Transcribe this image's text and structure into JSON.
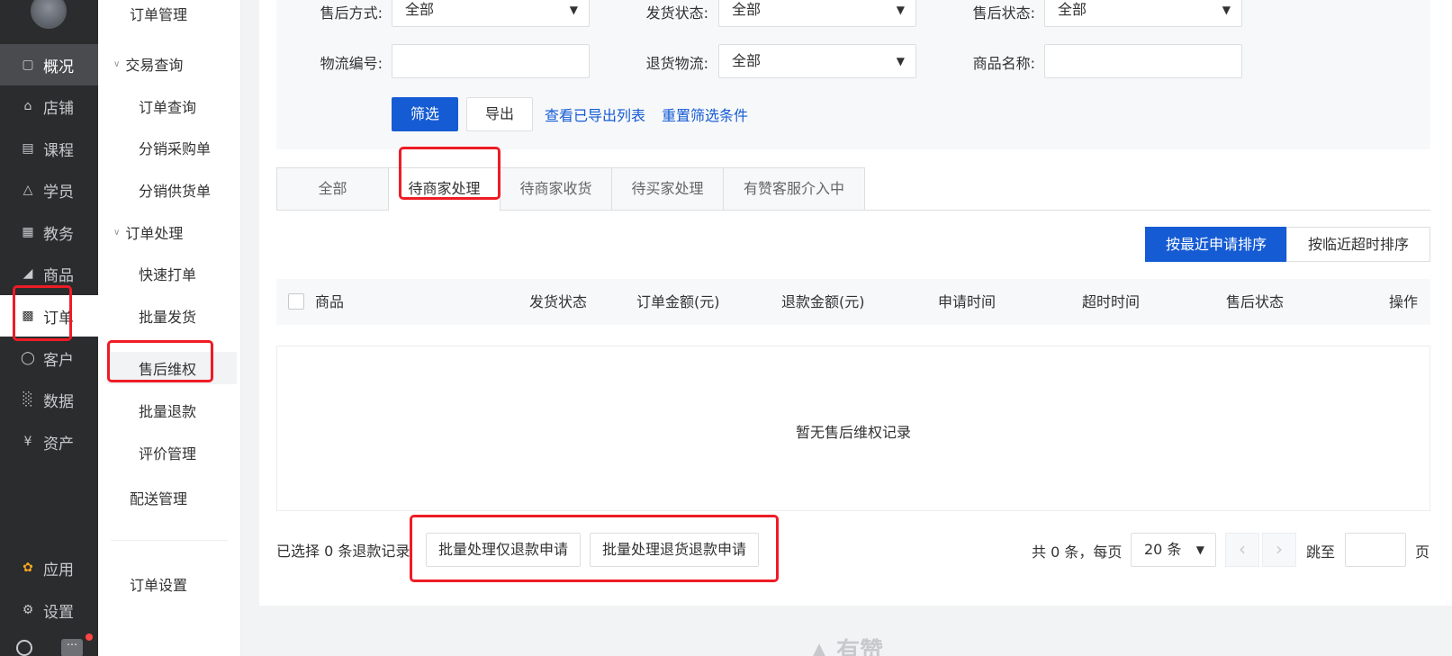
{
  "nav_primary": {
    "items": [
      {
        "label": "概况",
        "icon": "monitor-icon"
      },
      {
        "label": "店铺",
        "icon": "store-icon"
      },
      {
        "label": "课程",
        "icon": "book-icon"
      },
      {
        "label": "学员",
        "icon": "graduation-cap-icon"
      },
      {
        "label": "教务",
        "icon": "calendar-icon"
      },
      {
        "label": "商品",
        "icon": "tag-icon"
      },
      {
        "label": "订单",
        "icon": "order-doc-icon"
      },
      {
        "label": "客户",
        "icon": "user-icon"
      },
      {
        "label": "数据",
        "icon": "bar-chart-icon"
      },
      {
        "label": "资产",
        "icon": "yen-circle-icon"
      },
      {
        "label": "应用",
        "icon": "apps-icon"
      },
      {
        "label": "设置",
        "icon": "gear-icon"
      }
    ]
  },
  "nav_secondary": {
    "title": "订单管理",
    "group1": "交易查询",
    "group1_items": [
      "订单查询",
      "分销采购单",
      "分销供货单"
    ],
    "group2": "订单处理",
    "group2_items": [
      "快速打单",
      "批量发货",
      "售后维权",
      "批量退款",
      "评价管理"
    ],
    "delivery": "配送管理",
    "settings": "订单设置"
  },
  "filters": {
    "after_sale_method_label": "售后方式:",
    "after_sale_method_value": "全部",
    "ship_status_label": "发货状态:",
    "ship_status_value": "全部",
    "after_sale_status_label": "售后状态:",
    "after_sale_status_value": "全部",
    "logistics_no_label": "物流编号:",
    "return_logistics_label": "退货物流:",
    "return_logistics_value": "全部",
    "product_name_label": "商品名称:"
  },
  "actions": {
    "filter_btn": "筛选",
    "export_btn": "导出",
    "view_exported": "查看已导出列表",
    "reset_filters": "重置筛选条件"
  },
  "tabs": [
    "全部",
    "待商家处理",
    "待商家收货",
    "待买家处理",
    "有赞客服介入中"
  ],
  "sort": {
    "recent": "按最近申请排序",
    "timeout": "按临近超时排序"
  },
  "table": {
    "columns": [
      "商品",
      "发货状态",
      "订单金额(元)",
      "退款金额(元)",
      "申请时间",
      "超时时间",
      "售后状态",
      "操作"
    ],
    "empty": "暂无售后维权记录"
  },
  "bottom": {
    "selected_info": "已选择 0 条退款记录",
    "batch_refund_only": "批量处理仅退款申请",
    "batch_return_refund": "批量处理退货退款申请",
    "total": "共 0 条，每页",
    "page_size": "20 条",
    "jump_to": "跳至",
    "page_unit": "页"
  },
  "footer_brand": "有赞",
  "colors": {
    "primary": "#155bd4",
    "sidebar_bg": "#2b2c2e",
    "annotation_red": "#ee1c25"
  }
}
